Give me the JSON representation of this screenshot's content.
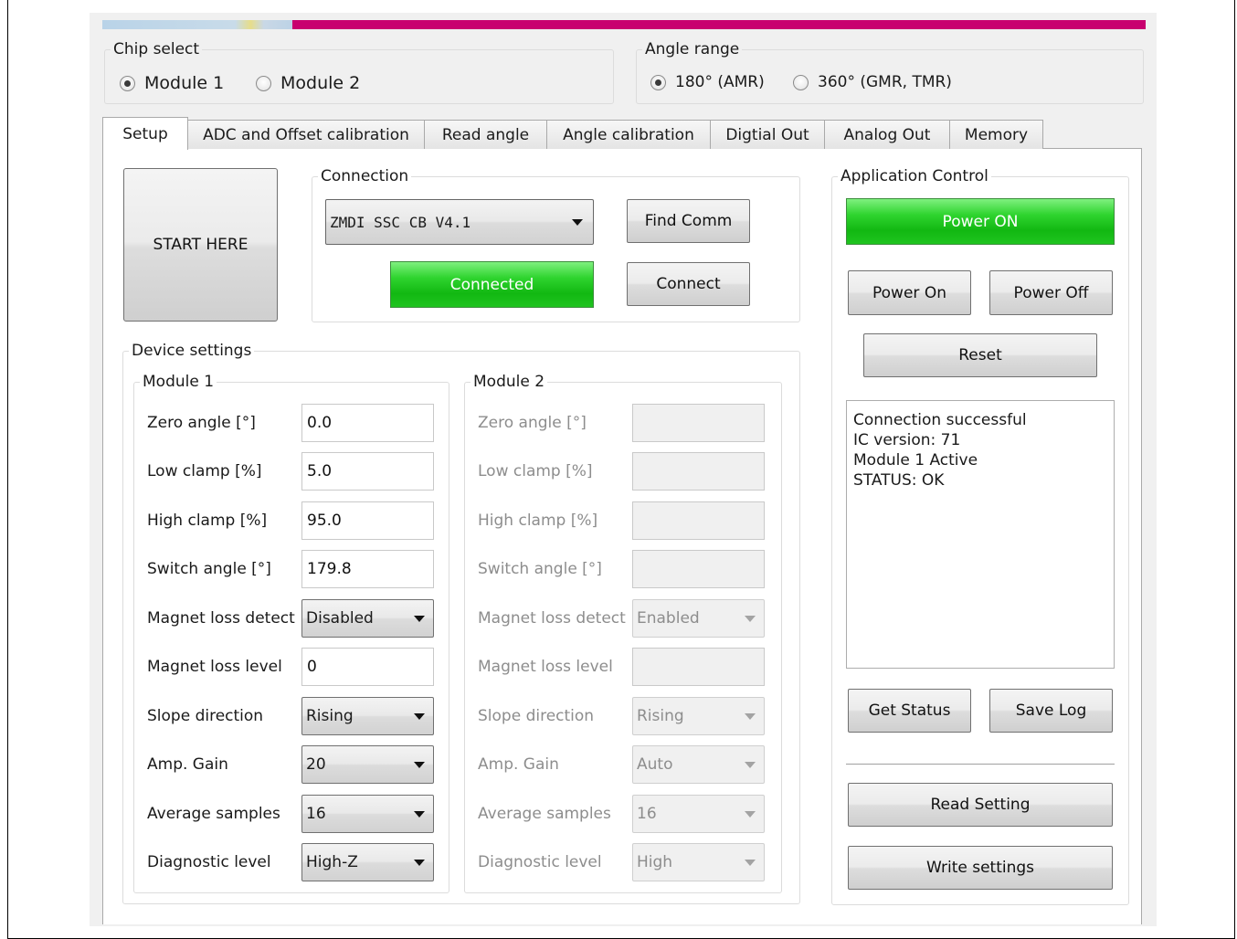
{
  "chip_select": {
    "legend": "Chip select",
    "options": [
      {
        "label": "Module 1",
        "selected": true
      },
      {
        "label": "Module 2",
        "selected": false
      }
    ]
  },
  "angle_range": {
    "legend": "Angle range",
    "options": [
      {
        "label": "180° (AMR)",
        "selected": true
      },
      {
        "label": "360° (GMR, TMR)",
        "selected": false
      }
    ]
  },
  "tabs": [
    {
      "label": "Setup",
      "active": true
    },
    {
      "label": "ADC and Offset calibration",
      "active": false
    },
    {
      "label": "Read angle",
      "active": false
    },
    {
      "label": "Angle calibration",
      "active": false
    },
    {
      "label": "Digtial Out",
      "active": false
    },
    {
      "label": "Analog Out",
      "active": false
    },
    {
      "label": "Memory",
      "active": false
    }
  ],
  "start_button": "START HERE",
  "connection": {
    "legend": "Connection",
    "device": "ZMDI SSC CB V4.1",
    "find_comm": "Find Comm",
    "status": "Connected",
    "connect": "Connect"
  },
  "device_settings": {
    "legend": "Device settings",
    "module1": {
      "legend": "Module 1",
      "zero_angle": {
        "label": "Zero angle [°]",
        "value": "0.0"
      },
      "low_clamp": {
        "label": "Low clamp [%]",
        "value": "5.0"
      },
      "high_clamp": {
        "label": "High clamp [%]",
        "value": "95.0"
      },
      "switch_angle": {
        "label": "Switch angle [°]",
        "value": "179.8"
      },
      "magnet_loss_detect": {
        "label": "Magnet loss detect",
        "value": "Disabled"
      },
      "magnet_loss_level": {
        "label": "Magnet loss level",
        "value": "0"
      },
      "slope_direction": {
        "label": "Slope direction",
        "value": "Rising"
      },
      "amp_gain": {
        "label": "Amp. Gain",
        "value": "20"
      },
      "average_samples": {
        "label": "Average samples",
        "value": "16"
      },
      "diagnostic_level": {
        "label": "Diagnostic level",
        "value": "High-Z"
      }
    },
    "module2": {
      "legend": "Module 2",
      "zero_angle": {
        "label": "Zero angle [°]",
        "value": ""
      },
      "low_clamp": {
        "label": "Low clamp [%]",
        "value": ""
      },
      "high_clamp": {
        "label": "High clamp [%]",
        "value": ""
      },
      "switch_angle": {
        "label": "Switch angle [°]",
        "value": ""
      },
      "magnet_loss_detect": {
        "label": "Magnet loss detect",
        "value": "Enabled"
      },
      "magnet_loss_level": {
        "label": "Magnet loss level",
        "value": ""
      },
      "slope_direction": {
        "label": "Slope direction",
        "value": "Rising"
      },
      "amp_gain": {
        "label": "Amp. Gain",
        "value": "Auto"
      },
      "average_samples": {
        "label": "Average samples",
        "value": "16"
      },
      "diagnostic_level": {
        "label": "Diagnostic level",
        "value": "High"
      }
    }
  },
  "application_control": {
    "legend": "Application Control",
    "power_status": "Power ON",
    "power_on": "Power On",
    "power_off": "Power Off",
    "reset": "Reset",
    "log": [
      "Connection successful",
      "IC version: 71",
      "Module 1 Active",
      "STATUS: OK"
    ],
    "get_status": "Get Status",
    "save_log": "Save Log",
    "read_setting": "Read Setting",
    "write_settings": "Write settings"
  },
  "colors": {
    "banner_accent": "#c8006f",
    "status_green": "#12b812"
  }
}
